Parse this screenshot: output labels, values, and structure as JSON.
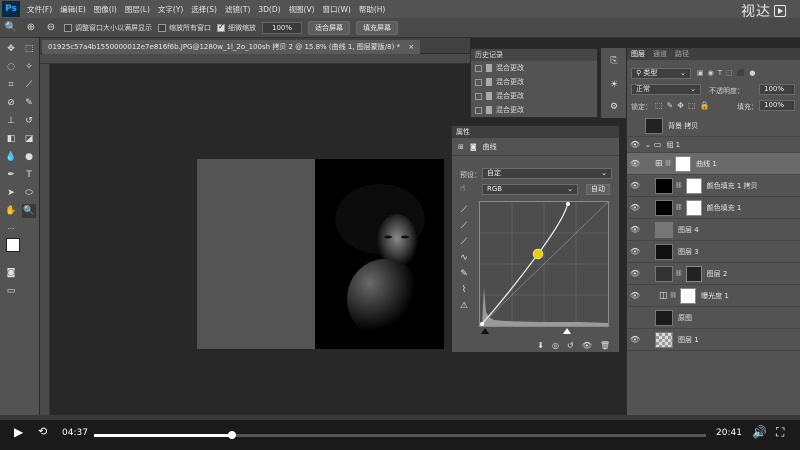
{
  "menubar": {
    "app_logo": "Ps",
    "items": [
      "文件(F)",
      "编辑(E)",
      "图像(I)",
      "图层(L)",
      "文字(Y)",
      "选择(S)",
      "滤镜(T)",
      "3D(D)",
      "视图(V)",
      "窗口(W)",
      "帮助(H)"
    ],
    "brand_text": "视达"
  },
  "options": {
    "resize_windows_label": "调整窗口大小以满屏显示",
    "zoom_all_label": "缩放所有窗口",
    "scrubby_zoom_label": "细微缩放",
    "zoom_value": "100%",
    "fit_screen": "适合屏幕",
    "fill_screen": "填充屏幕"
  },
  "document": {
    "tab_title": "01925c57a4b1550000012e7e816f6b.JPG@1280w_1l_2o_100sh 拷贝 2 @ 15.8% (曲线 1, 图层蒙版/8) *",
    "close": "×"
  },
  "history": {
    "title": "历史记录",
    "items": [
      "混合更改",
      "混合更改",
      "混合更改",
      "混合更改"
    ]
  },
  "properties": {
    "title": "属性",
    "adjustment_name": "曲线",
    "preset_label": "预设：",
    "preset_value": "自定",
    "channel_value": "RGB",
    "auto_button": "自动"
  },
  "layers": {
    "tabs": [
      "图层",
      "通道",
      "路径"
    ],
    "filter_label": "类型",
    "blend_mode": "正常",
    "opacity_label": "不透明度：",
    "opacity_value": "100%",
    "lock_label": "锁定：",
    "fill_label": "填充：",
    "fill_value": "100%",
    "items": [
      {
        "name": "背景 拷贝",
        "visible": false
      },
      {
        "name": "组 1",
        "visible": true
      },
      {
        "name": "曲线 1",
        "visible": true
      },
      {
        "name": "颜色填充 1 拷贝",
        "visible": true
      },
      {
        "name": "颜色填充 1",
        "visible": true
      },
      {
        "name": "图层 4",
        "visible": true
      },
      {
        "name": "图层 3",
        "visible": true
      },
      {
        "name": "图层 2",
        "visible": true
      },
      {
        "name": "曝光度 1",
        "visible": true
      },
      {
        "name": "原图",
        "visible": false
      },
      {
        "name": "图层 1",
        "visible": true
      }
    ]
  },
  "video": {
    "current_time": "04:37",
    "total_time": "20:41",
    "progress": 0.226
  },
  "colors": {
    "curve_point": "#e8d010"
  }
}
